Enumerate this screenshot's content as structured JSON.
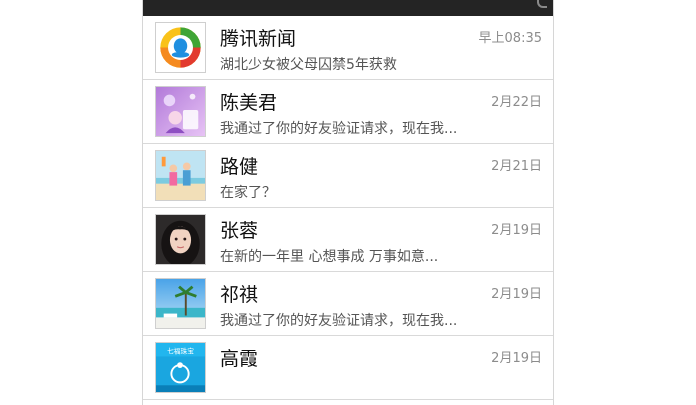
{
  "conversations": [
    {
      "name": "腾讯新闻",
      "time": "早上08:35",
      "preview": "湖北少女被父母囚禁5年获救",
      "avatar_icon": "tencent-news-logo"
    },
    {
      "name": "陈美君",
      "time": "2月22日",
      "preview": "我通过了你的好友验证请求，现在我...",
      "avatar_icon": "purple-cartoon-avatar"
    },
    {
      "name": "路健",
      "time": "2月21日",
      "preview": "在家了？",
      "avatar_icon": "couple-beach-avatar"
    },
    {
      "name": "张蓉",
      "time": "2月19日",
      "preview": "在新的一年里  心想事成  万事如意...",
      "avatar_icon": "girl-portrait-avatar"
    },
    {
      "name": "祁祺",
      "time": "2月19日",
      "preview": "我通过了你的好友验证请求，现在我...",
      "avatar_icon": "beach-palm-avatar"
    },
    {
      "name": "高霞",
      "time": "2月19日",
      "preview": "",
      "avatar_icon": "jewelry-ad-avatar",
      "avatar_text": "七福珠宝"
    }
  ],
  "colors": {
    "status_bar": "#242424",
    "divider": "#d9d9d9",
    "name_text": "#111111",
    "time_text": "#8c8c8c",
    "preview_text": "#555555"
  }
}
